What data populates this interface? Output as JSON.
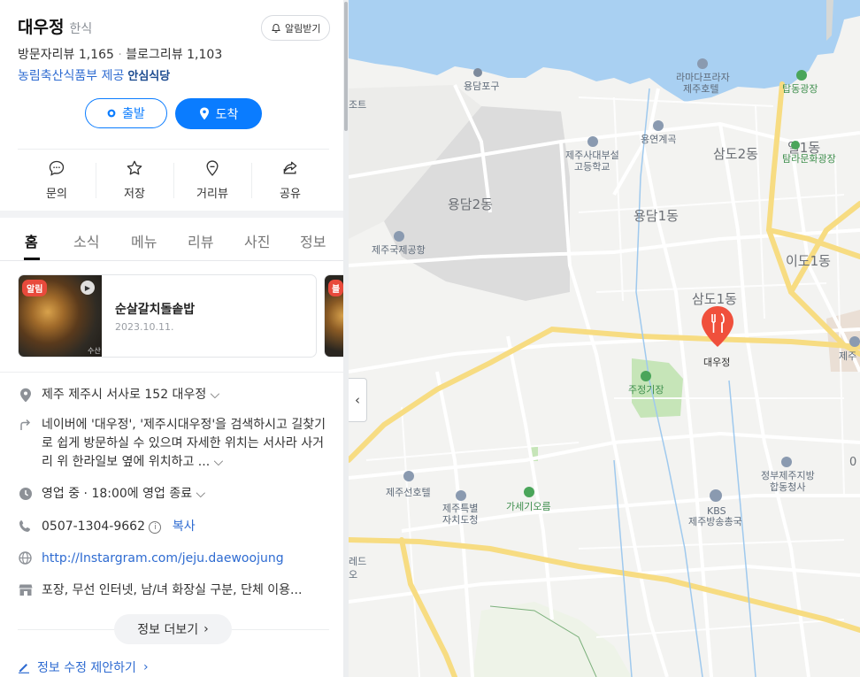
{
  "place": {
    "name": "대우정",
    "category": "한식",
    "alarm_label": "알림받기",
    "visitor_reviews": "방문자리뷰 1,165",
    "separator": "·",
    "blog_reviews": "블로그리뷰 1,103",
    "provider": "농림축산식품부 제공",
    "provider_badge": "안심식당"
  },
  "buttons": {
    "depart": "출발",
    "arrive": "도착"
  },
  "actions": [
    {
      "label": "문의",
      "icon": "chat-bubble-icon"
    },
    {
      "label": "저장",
      "icon": "star-icon"
    },
    {
      "label": "거리뷰",
      "icon": "location-pin-icon"
    },
    {
      "label": "공유",
      "icon": "share-icon"
    }
  ],
  "tabs": [
    "홈",
    "소식",
    "메뉴",
    "리뷰",
    "사진",
    "정보"
  ],
  "active_tab": "홈",
  "news_card": {
    "tag": "알림",
    "title": "순살갈치돌솥밥",
    "date": "2023.10.11.",
    "thumb_overlay": "수산",
    "next_tag": "블"
  },
  "info": {
    "address": "제주 제주시 서사로 152 대우정",
    "directions": "네이버에 '대우정', '제주시대우정'을 검색하시고 길찾기로 쉽게 방문하실 수 있으며 자세한 위치는 서사라 사거리 위 한라일보 옆에 위치하고 ...",
    "hours": "영업 중 · 18:00에 영업 종료",
    "phone": "0507-1304-9662",
    "copy_label": "복사",
    "website": "http://Instargram.com/jeju.daewoojung",
    "amenities": "포장, 무선 인터넷, 남/녀 화장실 구분, 단체 이용...",
    "more_label": "정보 더보기",
    "edit_label": "정보 수정 제안하기"
  },
  "map": {
    "marker_label": "대우정",
    "labels": {
      "yongdam_port": "용담포구",
      "jo": "조트",
      "ramada_1": "라마다프라자",
      "ramada_2": "제주호텔",
      "tapdong_plaza": "탑동광장",
      "yongyeon": "용연계곡",
      "jeju_univ_1": "제주사대부설",
      "jeju_univ_2": "고등학교",
      "samdo2": "삼도2동",
      "il1": "일1동",
      "tamra": "탐라문화광장",
      "yongdam2": "용담2동",
      "yongdam1": "용담1동",
      "airport": "제주국제공항",
      "ido1": "이도1동",
      "samdo1": "삼도1동",
      "jeju_right": "제주",
      "jujeong": "주정기장",
      "jejuseon": "제주선호텔",
      "jeju_special_1": "제주특별",
      "jeju_special_2": "자치도청",
      "gasaegi": "가세기오름",
      "kbs_1": "KBS",
      "kbs_2": "제주방송총국",
      "gov_1": "정부제주지방",
      "gov_2": "합동청사",
      "red": "레드",
      "o": "오",
      "zero": "0"
    }
  },
  "colors": {
    "accent": "#0a7cff",
    "link": "#2e6bd1",
    "marker": "#f0503c",
    "sea": "#a9d0f2",
    "road_major": "#f7dc82"
  }
}
